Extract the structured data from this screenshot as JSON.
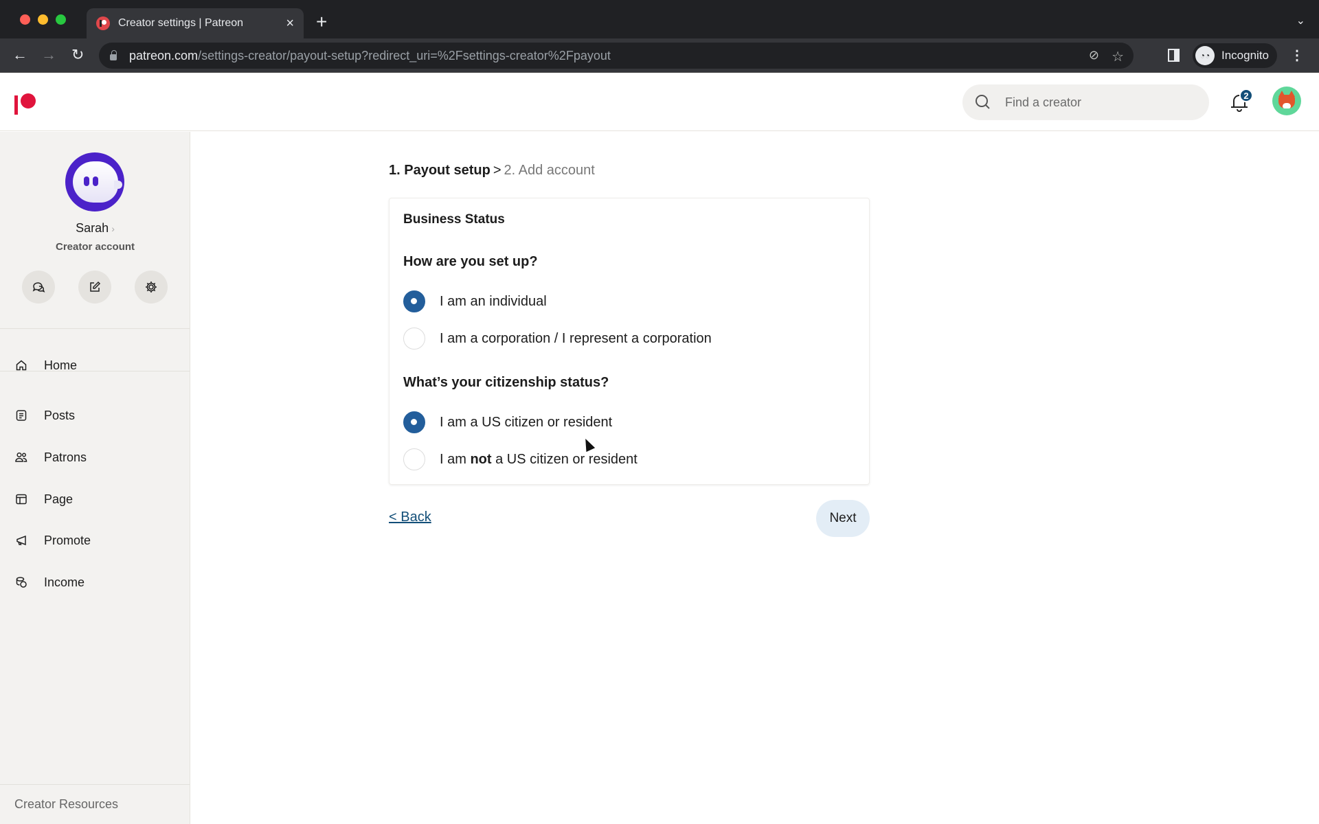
{
  "browser": {
    "tab_title": "Creator settings | Patreon",
    "tab_close": "×",
    "new_tab": "+",
    "tab_list": "⌄",
    "url_host": "patreon.com",
    "url_path": "/settings-creator/payout-setup?redirect_uri=%2Fsettings-creator%2Fpayout",
    "back": "←",
    "forward": "→",
    "reload": "↻",
    "eye_off_icon": "⊘",
    "star_icon": "☆",
    "incognito_label": "Incognito",
    "incognito_glyph": "◔◔",
    "menu": "⋮"
  },
  "header": {
    "search_placeholder": "Find a creator",
    "notification_count": "2"
  },
  "sidebar": {
    "creator_name": "Sarah",
    "creator_name_chevron": "›",
    "creator_type": "Creator account",
    "quick_actions": [
      "messages",
      "create-post",
      "settings"
    ],
    "nav": [
      {
        "label": "Home",
        "icon": "home-icon"
      },
      {
        "label": "Posts",
        "icon": "posts-icon"
      },
      {
        "label": "Patrons",
        "icon": "patrons-icon"
      },
      {
        "label": "Page",
        "icon": "page-icon"
      },
      {
        "label": "Promote",
        "icon": "megaphone-icon"
      },
      {
        "label": "Income",
        "icon": "income-icon"
      }
    ],
    "resources": "Creator Resources"
  },
  "main": {
    "breadcrumb": {
      "step1": "1. Payout setup",
      "separator": ">",
      "step2": "2. Add account"
    },
    "card_title": "Business Status",
    "setup_question": "How are you set up?",
    "setup_options": [
      {
        "label": "I am an individual",
        "checked": true
      },
      {
        "label": "I am a corporation / I represent a corporation",
        "checked": false
      }
    ],
    "citizenship_question": "What’s your citizenship status?",
    "citizenship_options": [
      {
        "label": "I am a US citizen or resident",
        "checked": true
      },
      {
        "prefix": "I am ",
        "bold": "not",
        "suffix": " a US citizen or resident",
        "checked": false
      }
    ],
    "back_label": "< Back",
    "next_label": "Next"
  }
}
